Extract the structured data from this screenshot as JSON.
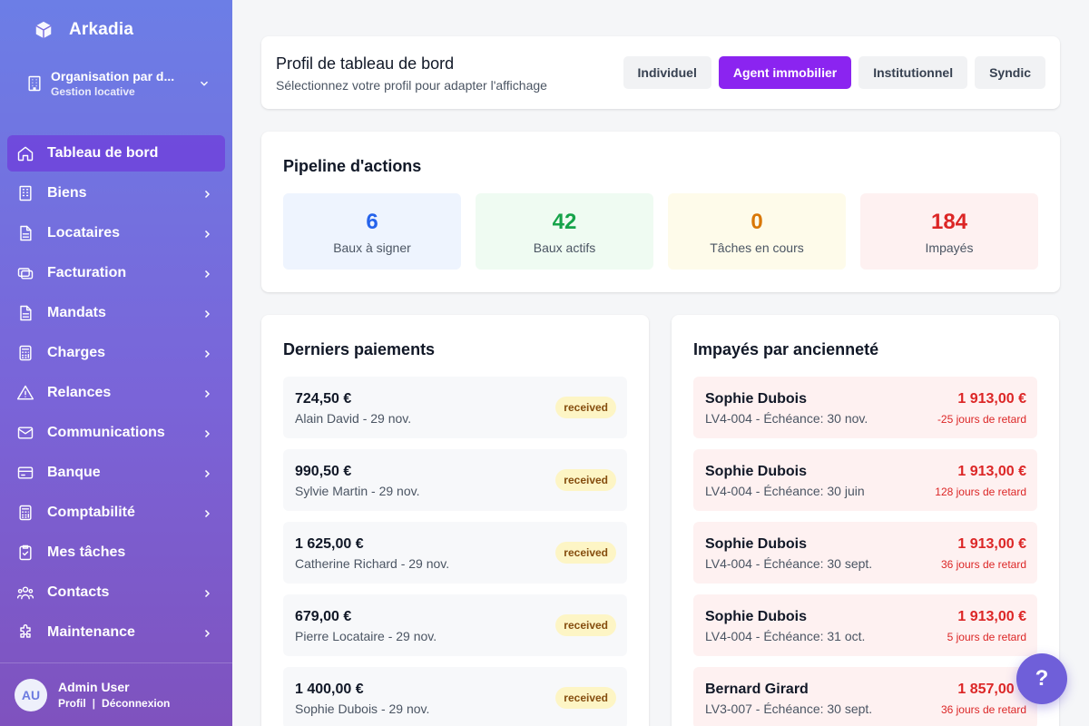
{
  "app": {
    "name": "Arkadia"
  },
  "org": {
    "name": "Organisation par d...",
    "subtitle": "Gestion locative"
  },
  "nav": [
    {
      "label": "Tableau de bord",
      "icon": "home-icon",
      "active": true,
      "chevron": false
    },
    {
      "label": "Biens",
      "icon": "building-icon",
      "chevron": true
    },
    {
      "label": "Locataires",
      "icon": "document-icon",
      "chevron": true
    },
    {
      "label": "Facturation",
      "icon": "cards-icon",
      "chevron": true
    },
    {
      "label": "Mandats",
      "icon": "document-icon",
      "chevron": true
    },
    {
      "label": "Charges",
      "icon": "calculator-icon",
      "chevron": true
    },
    {
      "label": "Relances",
      "icon": "warning-icon",
      "chevron": true
    },
    {
      "label": "Communications",
      "icon": "mail-icon",
      "chevron": true
    },
    {
      "label": "Banque",
      "icon": "credit-card-icon",
      "chevron": true
    },
    {
      "label": "Comptabilité",
      "icon": "calculator-icon",
      "chevron": true
    },
    {
      "label": "Mes tâches",
      "icon": "clipboard-check-icon",
      "chevron": false
    },
    {
      "label": "Contacts",
      "icon": "users-icon",
      "chevron": true
    },
    {
      "label": "Maintenance",
      "icon": "puzzle-icon",
      "chevron": true
    }
  ],
  "user": {
    "initials": "AU",
    "name": "Admin User",
    "profile_link": "Profil",
    "separator": "|",
    "logout_link": "Déconnexion"
  },
  "profile": {
    "title": "Profil de tableau de bord",
    "subtitle": "Sélectionnez votre profil pour adapter l'affichage",
    "options": [
      {
        "label": "Individuel",
        "active": false
      },
      {
        "label": "Agent immobilier",
        "active": true
      },
      {
        "label": "Institutionnel",
        "active": false
      },
      {
        "label": "Syndic",
        "active": false
      }
    ]
  },
  "pipeline": {
    "title": "Pipeline d'actions",
    "stats": [
      {
        "value": "6",
        "label": "Baux à signer",
        "color": "#2563eb"
      },
      {
        "value": "42",
        "label": "Baux actifs",
        "color": "#16a34a"
      },
      {
        "value": "0",
        "label": "Tâches en cours",
        "color": "#d97706"
      },
      {
        "value": "184",
        "label": "Impayés",
        "color": "#dc2626"
      }
    ]
  },
  "payments": {
    "title": "Derniers paiements",
    "items": [
      {
        "amount": "724,50 €",
        "meta": "Alain David - 29 nov.",
        "status": "received"
      },
      {
        "amount": "990,50 €",
        "meta": "Sylvie Martin - 29 nov.",
        "status": "received"
      },
      {
        "amount": "1 625,00 €",
        "meta": "Catherine Richard - 29 nov.",
        "status": "received"
      },
      {
        "amount": "679,00 €",
        "meta": "Pierre Locataire - 29 nov.",
        "status": "received"
      },
      {
        "amount": "1 400,00 €",
        "meta": "Sophie Dubois - 29 nov.",
        "status": "received"
      }
    ]
  },
  "arrears": {
    "title": "Impayés par ancienneté",
    "items": [
      {
        "name": "Sophie Dubois",
        "meta": "LV4-004 - Échéance: 30 nov.",
        "amount": "1 913,00 €",
        "days": "-25 jours de retard"
      },
      {
        "name": "Sophie Dubois",
        "meta": "LV4-004 - Échéance: 30 juin",
        "amount": "1 913,00 €",
        "days": "128 jours de retard"
      },
      {
        "name": "Sophie Dubois",
        "meta": "LV4-004 - Échéance: 30 sept.",
        "amount": "1 913,00 €",
        "days": "36 jours de retard"
      },
      {
        "name": "Sophie Dubois",
        "meta": "LV4-004 - Échéance: 31 oct.",
        "amount": "1 913,00 €",
        "days": "5 jours de retard"
      },
      {
        "name": "Bernard Girard",
        "meta": "LV3-007 - Échéance: 30 sept.",
        "amount": "1 857,00 €",
        "days": "36 jours de retard"
      }
    ]
  },
  "help": {
    "label": "?"
  }
}
